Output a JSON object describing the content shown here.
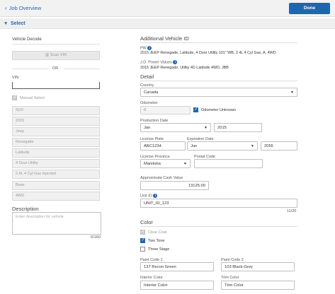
{
  "header": {
    "back_label": "Job Overview",
    "done_label": "Done"
  },
  "section": {
    "title": "Select"
  },
  "left": {
    "vehicle_decode_label": "Vehicle Decode",
    "scan_vin_label": "Scan VIN",
    "or_label": "OR",
    "vin_label": "VIN",
    "vin_value": "",
    "manual_select_label": "Manual Select",
    "decoded_fields": [
      "SUV",
      "2015",
      "Jeep",
      "Renegade",
      "Latitude",
      "4 Door Utility",
      "2.4L 4 Cyl Gas Injected",
      "Base",
      "4WD"
    ],
    "description_label": "Description",
    "description_placeholder": "Enter description for vehicle",
    "description_counter": "0/160"
  },
  "right": {
    "additional_title": "Additional Vehicle ID",
    "pw_label": "PW",
    "pw_value": "2015 JEEP Renegade, Latitude, 4 Door Utility 101\" WB, 2.4L 4 Cyl Gas, A, 4WD",
    "jdp_label": "J.D. Power Values",
    "jdp_value": "2015 JEEP Renegade, Utility 4D Latitude 4WD, JBB",
    "detail_title": "Detail",
    "country_label": "Country",
    "country_value": "Canada",
    "odometer_label": "Odometer",
    "odometer_value": "0",
    "odometer_unknown_label": "Odometer Unknown",
    "production_date_label": "Production Date",
    "production_month": "Jan",
    "production_year": "2015",
    "license_plate_label": "License Plate",
    "license_plate_value": "ABC1234",
    "expiration_date_label": "Expiration Date",
    "expiration_month": "Jun",
    "expiration_year": "2055",
    "license_province_label": "License Province",
    "license_province_value": "Manitoba",
    "postal_code_label": "Postal Code",
    "postal_code_value": "",
    "cash_value_label": "Approximate Cash Value",
    "cash_value": "13125.00",
    "unit_id_label": "Unit ID",
    "unit_id_value": "UNIT_ID_123",
    "unit_id_counter": "11/20",
    "color_title": "Color",
    "clear_coat_label": "Clear Coat",
    "two_tone_label": "Two Tone",
    "three_stage_label": "Three Stage",
    "paint_code_1_label": "Paint Code 1",
    "paint_code_1_value": "137 Recon Green",
    "paint_code_2_label": "Paint Code 2",
    "paint_code_2_value": "103 Black-Grey",
    "interior_color_label": "Interior Color",
    "interior_color_value": "Interior Color",
    "trim_color_label": "Trim Color",
    "trim_color_value": "Trim Color"
  },
  "icons": {
    "back": "chevron-left-icon",
    "collapse": "triangle-down-icon",
    "caret": "caret-down-icon",
    "info": "info-icon",
    "barcode": "barcode-icon"
  },
  "colors": {
    "accent": "#1f66b0"
  }
}
